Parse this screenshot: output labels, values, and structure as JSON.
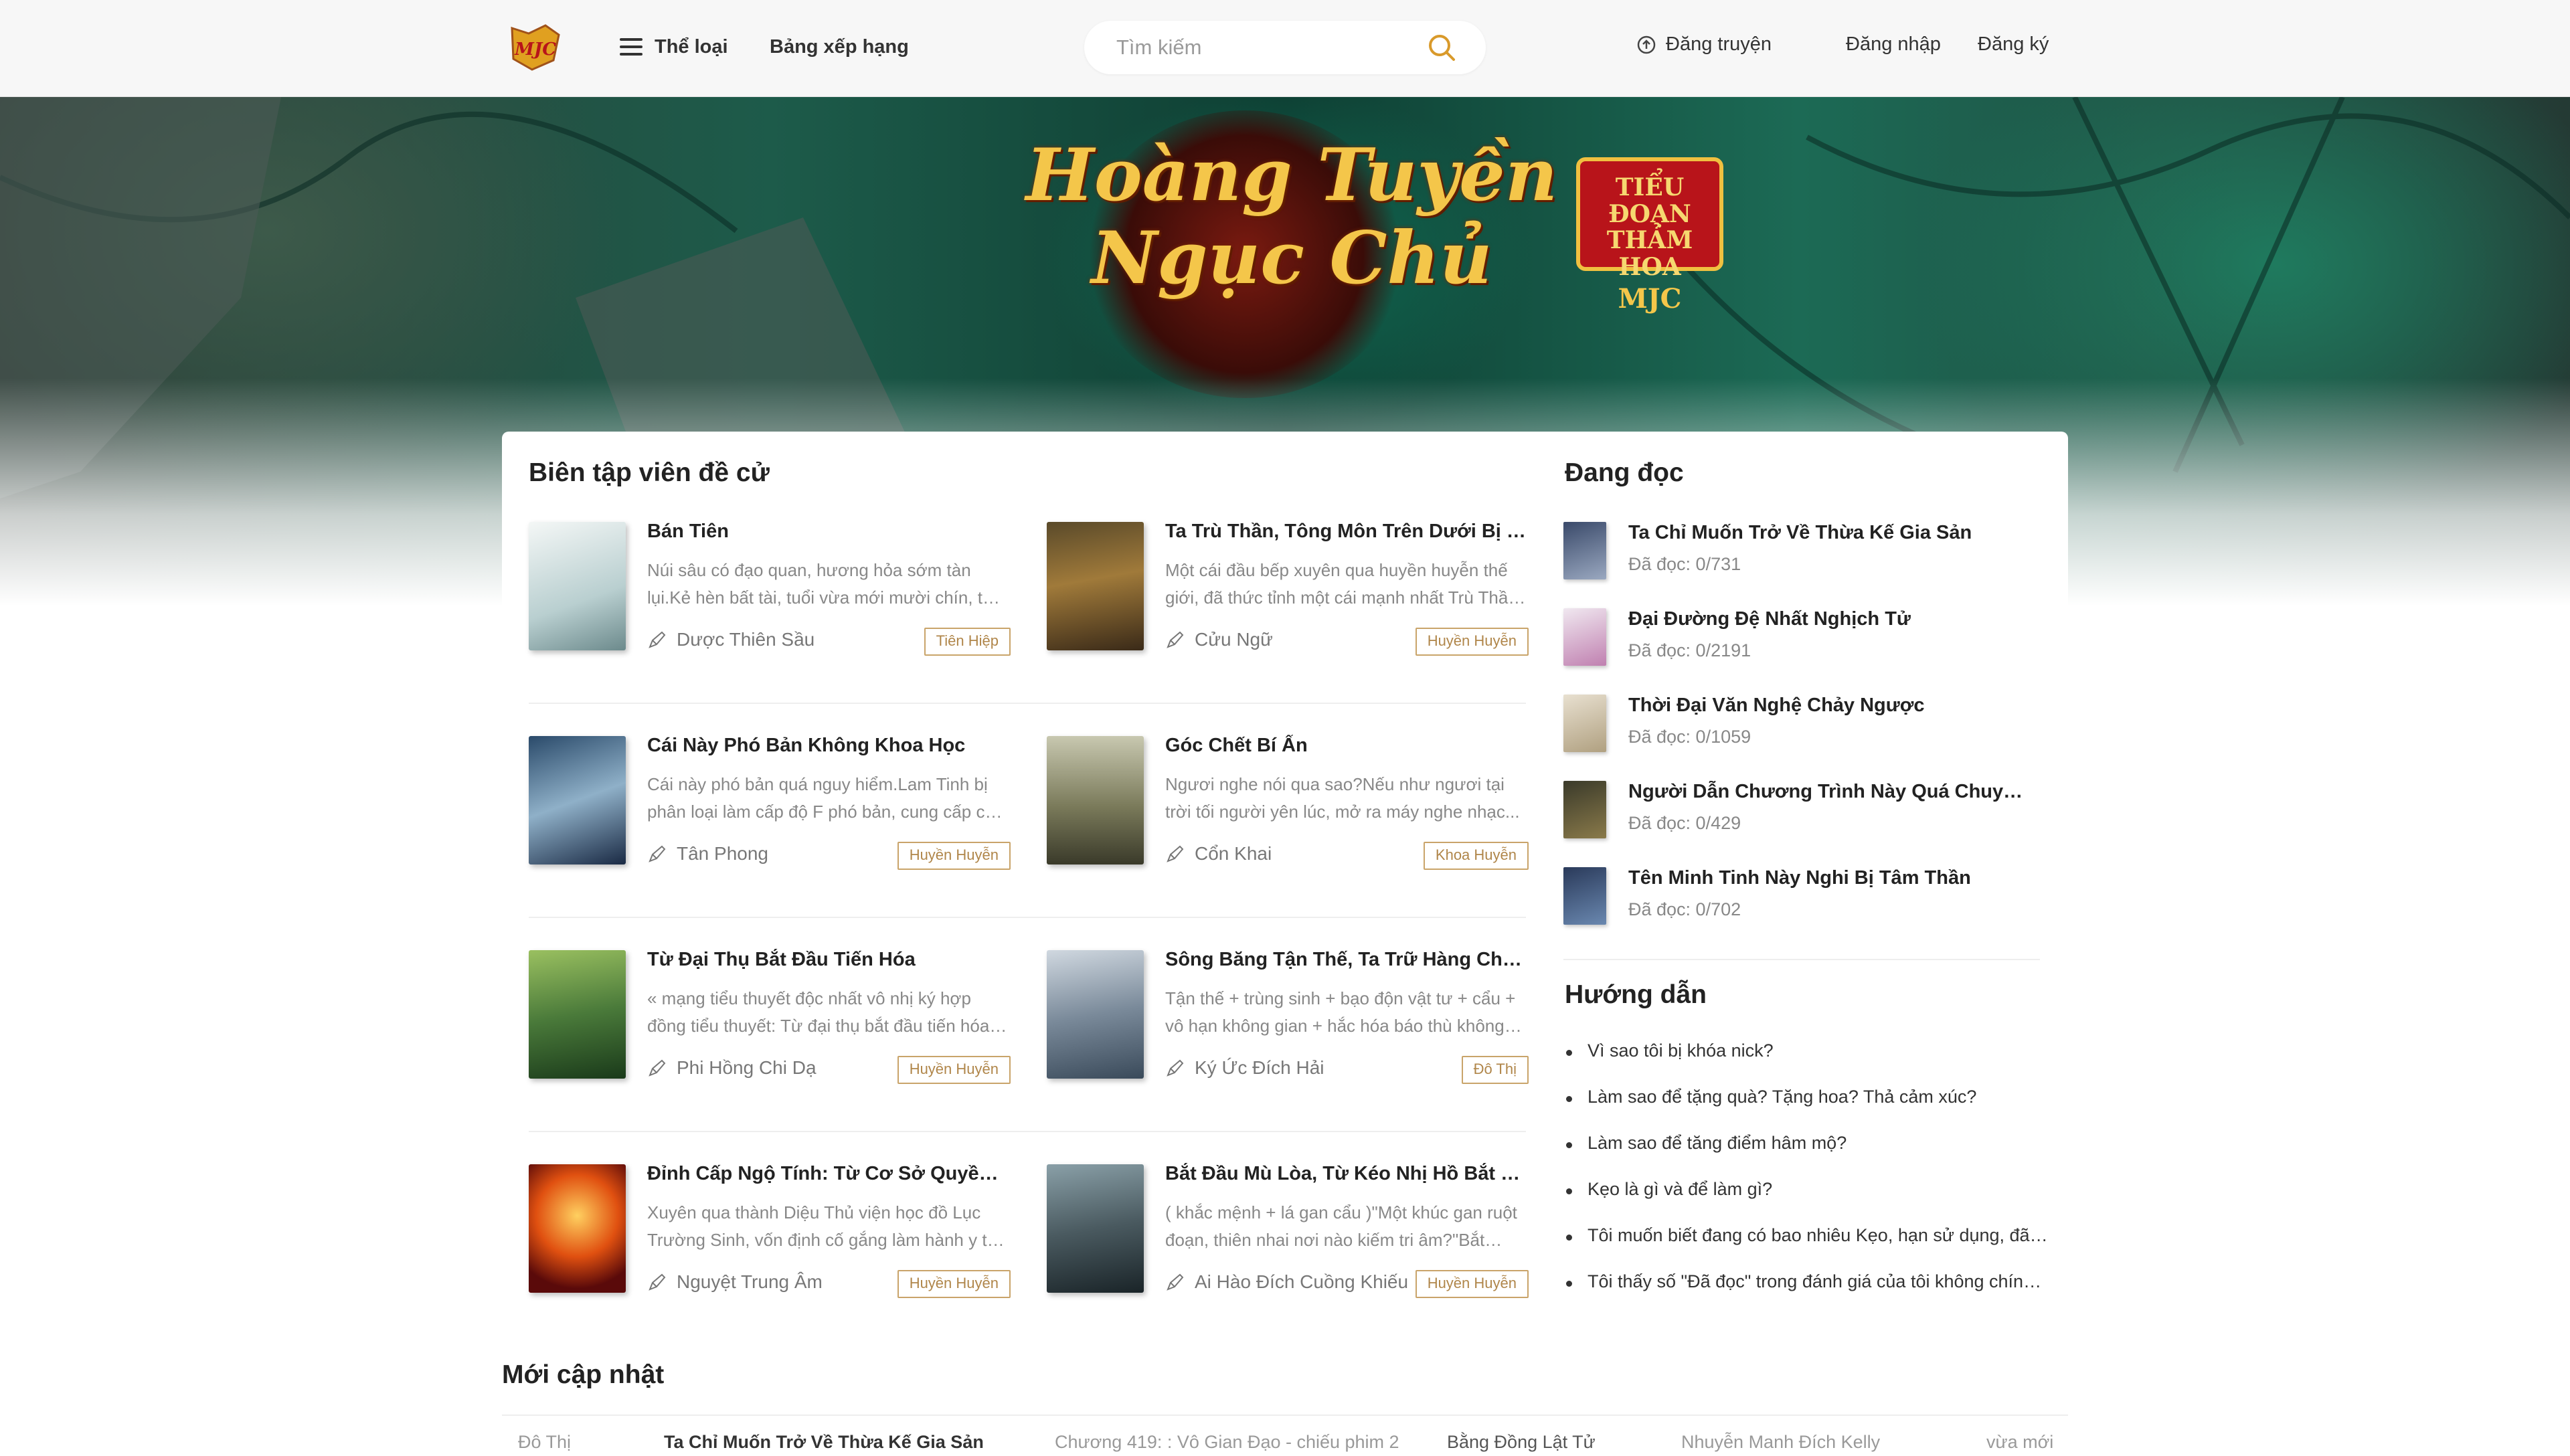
{
  "header": {
    "logo_text": "MJC",
    "menu_label": "Thể loại",
    "ranking_label": "Bảng xếp hạng",
    "search_placeholder": "Tìm kiếm",
    "upload_label": "Đăng truyện",
    "login_label": "Đăng nhập",
    "register_label": "Đăng ký"
  },
  "banner": {
    "title_line1": "Hoàng Tuyền",
    "title_line2": "Ngục Chủ",
    "badge_line1": "TIỂU ĐOẠN",
    "badge_line2": "THẢM HOA",
    "badge_logo": "MJC"
  },
  "recommended": {
    "title": "Biên tập viên đề cử",
    "books": [
      {
        "title": "Bán Tiên",
        "desc": "Núi sâu có đạo quan, hương hỏa sớm tàn lụi.Kẻ hèn bất tài, tuổi vừa mới mười chín, tu vi...",
        "author": "Dược Thiên Sầu",
        "tag": "Tiên Hiệp"
      },
      {
        "title": "Ta Trù Thần, Tông Môn Trên Dưới Bị Ta Cho Ăn Thành Đại Đế",
        "desc": "Một cái đầu bếp xuyên qua huyền huyễn thế giới, đã thức tỉnh một cái mạnh nhất Trù Thần hệ thống...",
        "author": "Cửu Ngữ",
        "tag": "Huyền Huyễn"
      },
      {
        "title": "Cái Này Phó Bản Không Khoa Học",
        "desc": "Cái này phó bản quá nguy hiểm.Lam Tinh bị phân loại làm cấp độ F phó bản, cung cấp cho các...",
        "author": "Tân Phong",
        "tag": "Huyền Huyễn"
      },
      {
        "title": "Góc Chết Bí Ẩn",
        "desc": "Ngươi nghe nói qua sao?Nếu như ngươi tại trời tối người yên lúc, mở ra máy nghe nhạc...",
        "author": "Cổn Khai",
        "tag": "Khoa Huyễn"
      },
      {
        "title": "Từ Đại Thụ Bắt Đầu Tiến Hóa",
        "desc": "« mạng tiểu thuyết độc nhất vô nhị ký hợp đồng tiểu thuyết: Từ đại thụ bắt đầu tiến hóa »...",
        "author": "Phi Hồng Chi Dạ",
        "tag": "Huyền Huyễn"
      },
      {
        "title": "Sông Băng Tận Thế, Ta Trữ Hàng Chục Ức Vật Tư",
        "desc": "Tận thế + trùng sinh + bạo độn vật tư + cẩu + vô hạn không gian + hắc hóa báo thù không thánh mẫu...",
        "author": "Ký Ức Đích Hải",
        "tag": "Đô Thị"
      },
      {
        "title": "Đỉnh Cấp Ngộ Tính: Từ Cơ Sở Quyền Pháp Bắt Đầu",
        "desc": "Xuyên qua thành Diệu Thủ viện học đồ Lục Trường Sinh, vốn định cố gắng làm hành y tế thế...",
        "author": "Nguyệt Trung Âm",
        "tag": "Huyền Huyễn"
      },
      {
        "title": "Bắt Đầu Mù Lòa, Từ Kéo Nhị Hồ Bắt Đầu",
        "desc": "( khắc mệnh + lá gan cẩu )\"Một khúc gan ruột đoạn, thiên nhai nơi nào kiếm tri âm?\"Bắt đầu...",
        "author": "Ai Hào Đích Cuồng Khiếu",
        "tag": "Huyền Huyễn"
      }
    ]
  },
  "reading": {
    "title": "Đang đọc",
    "items": [
      {
        "title": "Ta Chỉ Muốn Trở Về Thừa Kế Gia Sản",
        "progress": "Đã đọc: 0/731"
      },
      {
        "title": "Đại Đường Đệ Nhất Nghịch Tử",
        "progress": "Đã đọc: 0/2191"
      },
      {
        "title": "Thời Đại Văn Nghệ Chảy Ngược",
        "progress": "Đã đọc: 0/1059"
      },
      {
        "title": "Người Dẫn Chương Trình Này Quá Chuyên Nghiệp",
        "progress": "Đã đọc: 0/429"
      },
      {
        "title": "Tên Minh Tinh Này Nghi Bị Tâm Thần",
        "progress": "Đã đọc: 0/702"
      }
    ]
  },
  "guide": {
    "title": "Hướng dẫn",
    "items": [
      "Vì sao tôi bị khóa nick?",
      "Làm sao để tặng quà? Tặng hoa? Thả cảm xúc?",
      "Làm sao để tăng điểm hâm mộ?",
      "Kẹo là gì và để làm gì?",
      "Tôi muốn biết đang có bao nhiêu Kẹo, hạn sử dụng, đã dùng bao nhiêu?",
      "Tôi thấy số \"Đã đọc\" trong đánh giá của tôi không chính xác?"
    ]
  },
  "latest": {
    "title": "Mới cập nhật",
    "row": {
      "genre": "Đô Thị",
      "book": "Ta Chỉ Muốn Trở Về Thừa Kế Gia Sản",
      "chapter": "Chương 419: : Vô Gian Đạo - chiếu phim 2",
      "next_book": "Bằng Đồng Lật Tử",
      "author": "Nhuyễn Manh Đích Kelly",
      "time": "vừa mới"
    }
  },
  "colors": {
    "tag_border": "#c9a46a",
    "tag_text": "#b0864a",
    "header_bg": "#f7f7f7",
    "search_icon": "#d99a2b"
  }
}
